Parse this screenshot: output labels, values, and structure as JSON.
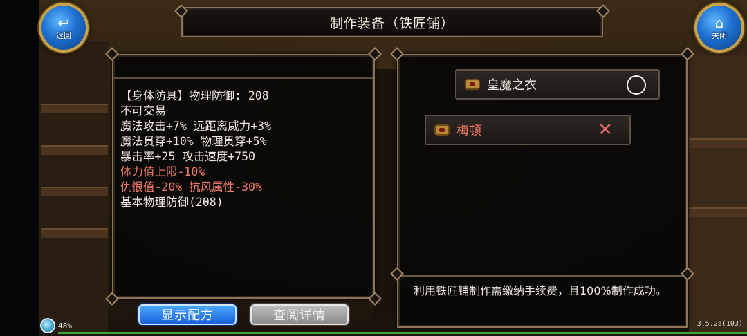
{
  "title": "制作装备（铁匠铺）",
  "nav": {
    "back_label": "返回",
    "close_label": "关闭"
  },
  "item_stats": [
    {
      "text": "【身体防具】物理防御: 208",
      "color": "white"
    },
    {
      "text": "不可交易",
      "color": "white"
    },
    {
      "text": "魔法攻击+7% 远距离威力+3%",
      "color": "white"
    },
    {
      "text": "魔法贯穿+10% 物理贯穿+5%",
      "color": "white"
    },
    {
      "text": "暴击率+25 攻击速度+750",
      "color": "white"
    },
    {
      "text": "体力值上限-10%",
      "color": "red"
    },
    {
      "text": "仇恨值-20% 抗风属性-30%",
      "color": "red"
    },
    {
      "text": "基本物理防御(208)",
      "color": "white"
    }
  ],
  "materials": [
    {
      "name": "皇魔之衣",
      "status": "satisfied"
    },
    {
      "name": "梅顿",
      "status": "missing"
    }
  ],
  "note": "利用铁匠铺制作需缴纳手续费，且100%制作成功。",
  "buttons": {
    "show_recipe": "显示配方",
    "view_details": "查阅详情"
  },
  "status_bar": {
    "battery": "48%",
    "version": "3.5.2a(103)"
  },
  "colors": {
    "accent_blue": "#1a62d8",
    "negative_red": "#f07a6a",
    "frame_gold": "#c8a24a"
  }
}
